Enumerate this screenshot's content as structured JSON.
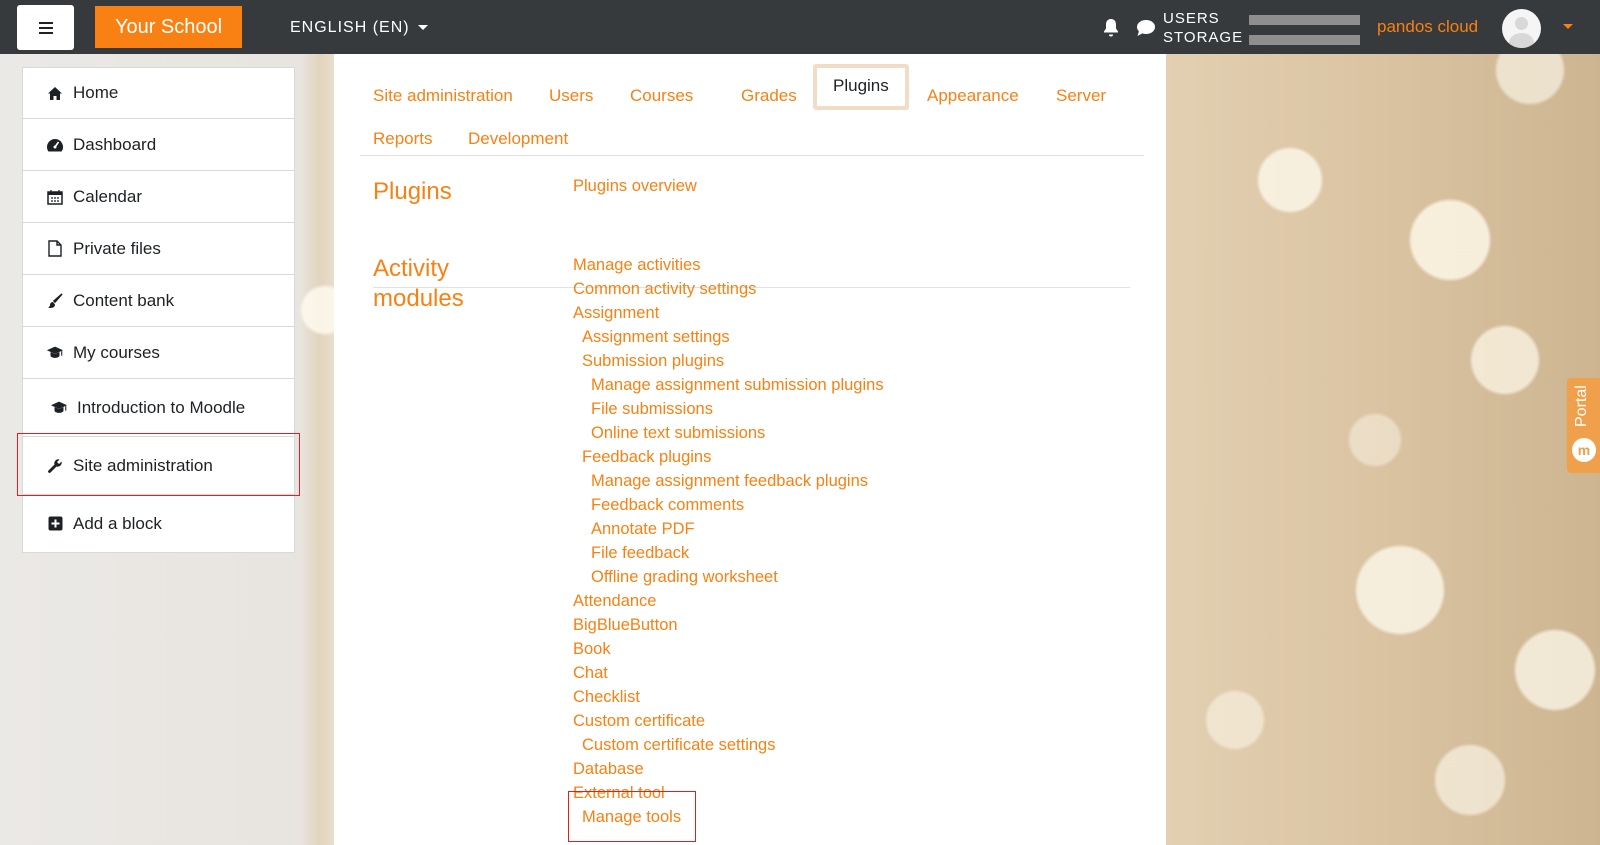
{
  "navbar": {
    "brand": "Your School",
    "language": "ENGLISH (EN)",
    "quota_users": "USERS",
    "quota_storage": "STORAGE",
    "tenant": "pandos cloud"
  },
  "sidebar": {
    "items": [
      {
        "label": "Home",
        "icon": "home-icon"
      },
      {
        "label": "Dashboard",
        "icon": "dashboard-icon"
      },
      {
        "label": "Calendar",
        "icon": "calendar-icon"
      },
      {
        "label": "Private files",
        "icon": "file-icon"
      },
      {
        "label": "Content bank",
        "icon": "paintbrush-icon"
      },
      {
        "label": "My courses",
        "icon": "graduation-cap-icon"
      },
      {
        "label": "Introduction to Moodle",
        "icon": "graduation-cap-icon"
      },
      {
        "label": "Site administration",
        "icon": "wrench-icon"
      },
      {
        "label": "Add a block",
        "icon": "plus-square-icon"
      }
    ]
  },
  "tabs": [
    "Site administration",
    "Users",
    "Courses",
    "Grades",
    "Plugins",
    "Appearance",
    "Server",
    "Reports",
    "Development"
  ],
  "active_tab": "Plugins",
  "sections": {
    "plugins": {
      "title": "Plugins",
      "links": [
        "Plugins overview"
      ]
    },
    "activity_modules": {
      "title_line1": "Activity",
      "title_line2": "modules",
      "links": [
        "Manage activities",
        "Common activity settings",
        "Assignment",
        "Assignment settings",
        "Submission plugins",
        "Manage assignment submission plugins",
        "File submissions",
        "Online text submissions",
        "Feedback plugins",
        "Manage assignment feedback plugins",
        "Feedback comments",
        "Annotate PDF",
        "File feedback",
        "Offline grading worksheet",
        "Attendance",
        "BigBlueButton",
        "Book",
        "Chat",
        "Checklist",
        "Custom certificate",
        "Custom certificate settings",
        "Database",
        "External tool",
        "Manage tools"
      ]
    }
  },
  "portal_tab": "Portal",
  "colors": {
    "accent": "#f98012",
    "navbar": "#373a3c",
    "highlight": "#e02020"
  }
}
